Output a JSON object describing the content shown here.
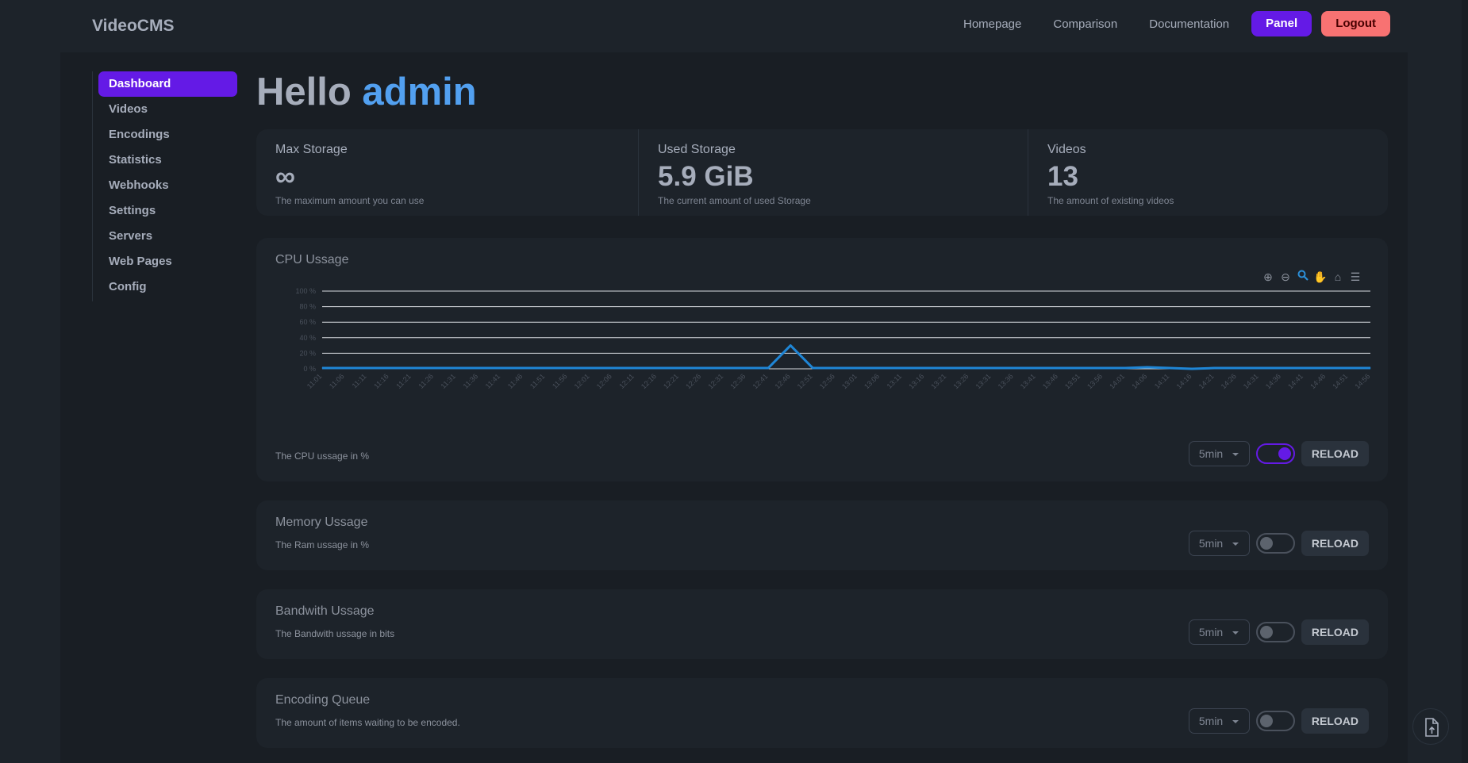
{
  "app": {
    "title": "VideoCMS"
  },
  "nav": {
    "links": [
      "Homepage",
      "Comparison",
      "Documentation"
    ],
    "panel": "Panel",
    "logout": "Logout"
  },
  "sidebar": {
    "items": [
      {
        "label": "Dashboard",
        "active": true
      },
      {
        "label": "Videos"
      },
      {
        "label": "Encodings"
      },
      {
        "label": "Statistics"
      },
      {
        "label": "Webhooks"
      },
      {
        "label": "Settings"
      },
      {
        "label": "Servers"
      },
      {
        "label": "Web Pages"
      },
      {
        "label": "Config"
      }
    ]
  },
  "greeting": {
    "hello": "Hello",
    "user": "admin"
  },
  "stats": [
    {
      "title": "Max Storage",
      "value": "∞",
      "desc": "The maximum amount you can use"
    },
    {
      "title": "Used Storage",
      "value": "5.9 GiB",
      "desc": "The current amount of used Storage"
    },
    {
      "title": "Videos",
      "value": "13",
      "desc": "The amount of existing videos"
    }
  ],
  "cards": [
    {
      "title": "CPU Ussage",
      "desc": "The CPU ussage in %",
      "interval": "5min",
      "live": true,
      "reload": "RELOAD"
    },
    {
      "title": "Memory Ussage",
      "desc": "The Ram ussage in %",
      "interval": "5min",
      "live": false,
      "reload": "RELOAD"
    },
    {
      "title": "Bandwith Ussage",
      "desc": "The Bandwith ussage in bits",
      "interval": "5min",
      "live": false,
      "reload": "RELOAD"
    },
    {
      "title": "Encoding Queue",
      "desc": "The amount of items waiting to be encoded.",
      "interval": "5min",
      "live": false,
      "reload": "RELOAD"
    }
  ],
  "toolbar_icons": [
    "zoom-in-icon",
    "zoom-out-icon",
    "zoom-select-icon",
    "pan-hand-icon",
    "home-icon",
    "menu-icon"
  ],
  "colors": {
    "accent": "#641ae6",
    "logout": "#f87272",
    "series": "#1f86d6",
    "user": "#52a0f0"
  },
  "chart_data": {
    "type": "line",
    "title": "",
    "ylabel": "",
    "ylim": [
      0,
      100
    ],
    "yticks": [
      "100 %",
      "80 %",
      "60 %",
      "40 %",
      "20 %",
      "0 %"
    ],
    "x": [
      "11:01",
      "11:06",
      "11:11",
      "11:16",
      "11:21",
      "11:26",
      "11:31",
      "11:36",
      "11:41",
      "11:46",
      "11:51",
      "11:56",
      "12:01",
      "12:06",
      "12:11",
      "12:16",
      "12:21",
      "12:26",
      "12:31",
      "12:36",
      "12:41",
      "12:46",
      "12:51",
      "12:56",
      "13:01",
      "13:06",
      "13:11",
      "13:16",
      "13:21",
      "13:26",
      "13:31",
      "13:36",
      "13:41",
      "13:46",
      "13:51",
      "13:56",
      "14:01",
      "14:06",
      "14:11",
      "14:16",
      "14:21",
      "14:26",
      "14:31",
      "14:36",
      "14:41",
      "14:46",
      "14:51",
      "14:56"
    ],
    "series": [
      {
        "values": [
          1,
          1,
          1,
          1,
          1,
          1,
          1,
          1,
          1,
          1,
          1,
          1,
          1,
          1,
          1,
          1,
          1,
          1,
          1,
          1,
          1,
          30,
          1,
          1,
          1,
          1,
          1,
          1,
          1,
          1,
          1,
          1,
          1,
          1,
          1,
          1,
          1,
          2,
          1,
          0,
          1,
          1,
          1,
          1,
          1,
          1,
          1,
          1
        ]
      }
    ],
    "grid": true
  }
}
